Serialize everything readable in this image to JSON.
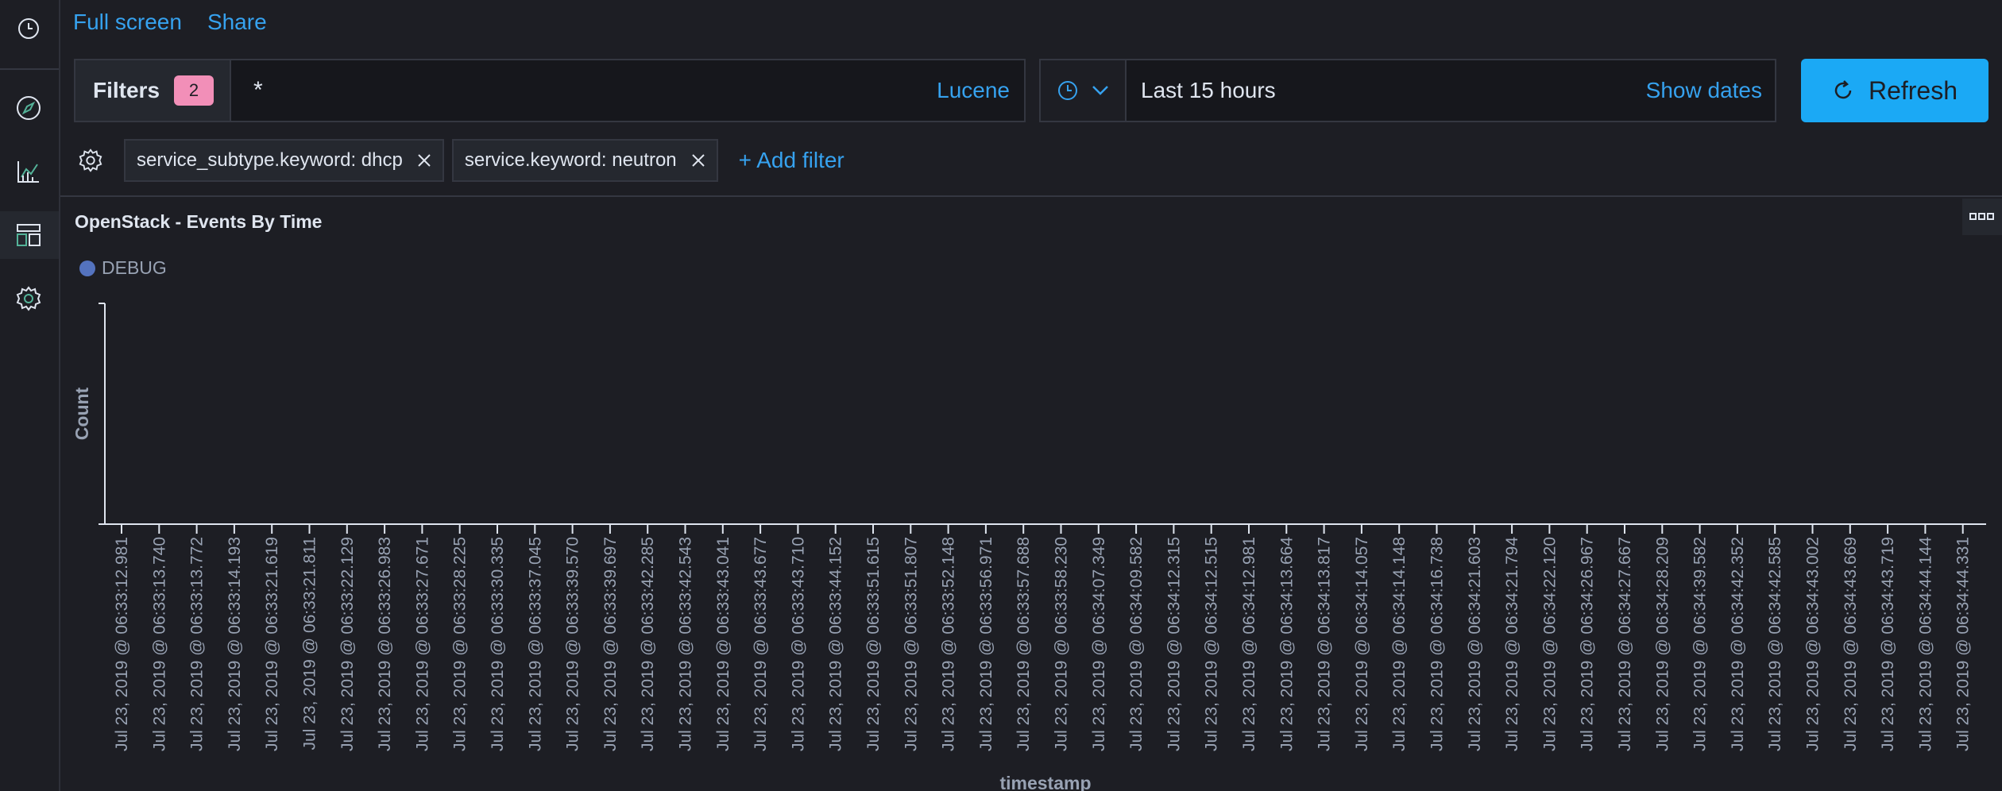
{
  "topbar": {
    "full_screen": "Full screen",
    "share": "Share"
  },
  "query": {
    "filters_label": "Filters",
    "filters_count": "2",
    "text": "*",
    "language": "Lucene"
  },
  "time": {
    "range": "Last 15 hours",
    "show_dates": "Show dates"
  },
  "refresh": {
    "label": "Refresh"
  },
  "filters": [
    {
      "label": "service_subtype.keyword: dhcp"
    },
    {
      "label": "service.keyword: neutron"
    }
  ],
  "add_filter": "+ Add filter",
  "panel": {
    "title": "OpenStack - Events By Time"
  },
  "colors": {
    "accent": "#36a2ef",
    "button": "#1ba9f5",
    "badge": "#f28fb8",
    "series": "#5473bf",
    "background": "#1d1e24"
  },
  "icons": {
    "history": "clock-icon",
    "discover": "compass-icon",
    "visualize": "chart-icon",
    "dashboard": "dashboard-icon",
    "settings": "gear-icon"
  },
  "chart_data": {
    "type": "bar",
    "xlabel": "timestamp",
    "ylabel": "Count",
    "legend": [
      "DEBUG"
    ],
    "legend_position": "top-left",
    "categories": [
      "Jul 23, 2019 @ 06:33:12.981",
      "Jul 23, 2019 @ 06:33:13.740",
      "Jul 23, 2019 @ 06:33:13.772",
      "Jul 23, 2019 @ 06:33:14.193",
      "Jul 23, 2019 @ 06:33:21.619",
      "Jul 23, 2019 @ 06:33:21.811",
      "Jul 23, 2019 @ 06:33:22.129",
      "Jul 23, 2019 @ 06:33:26.983",
      "Jul 23, 2019 @ 06:33:27.671",
      "Jul 23, 2019 @ 06:33:28.225",
      "Jul 23, 2019 @ 06:33:30.335",
      "Jul 23, 2019 @ 06:33:37.045",
      "Jul 23, 2019 @ 06:33:39.570",
      "Jul 23, 2019 @ 06:33:39.697",
      "Jul 23, 2019 @ 06:33:42.285",
      "Jul 23, 2019 @ 06:33:42.543",
      "Jul 23, 2019 @ 06:33:43.041",
      "Jul 23, 2019 @ 06:33:43.677",
      "Jul 23, 2019 @ 06:33:43.710",
      "Jul 23, 2019 @ 06:33:44.152",
      "Jul 23, 2019 @ 06:33:51.615",
      "Jul 23, 2019 @ 06:33:51.807",
      "Jul 23, 2019 @ 06:33:52.148",
      "Jul 23, 2019 @ 06:33:56.971",
      "Jul 23, 2019 @ 06:33:57.688",
      "Jul 23, 2019 @ 06:33:58.230",
      "Jul 23, 2019 @ 06:34:07.349",
      "Jul 23, 2019 @ 06:34:09.582",
      "Jul 23, 2019 @ 06:34:12.315",
      "Jul 23, 2019 @ 06:34:12.515",
      "Jul 23, 2019 @ 06:34:12.981",
      "Jul 23, 2019 @ 06:34:13.664",
      "Jul 23, 2019 @ 06:34:13.817",
      "Jul 23, 2019 @ 06:34:14.057",
      "Jul 23, 2019 @ 06:34:14.148",
      "Jul 23, 2019 @ 06:34:16.738",
      "Jul 23, 2019 @ 06:34:21.603",
      "Jul 23, 2019 @ 06:34:21.794",
      "Jul 23, 2019 @ 06:34:22.120",
      "Jul 23, 2019 @ 06:34:26.967",
      "Jul 23, 2019 @ 06:34:27.667",
      "Jul 23, 2019 @ 06:34:28.209",
      "Jul 23, 2019 @ 06:34:39.582",
      "Jul 23, 2019 @ 06:34:42.352",
      "Jul 23, 2019 @ 06:34:42.585",
      "Jul 23, 2019 @ 06:34:43.002",
      "Jul 23, 2019 @ 06:34:43.669",
      "Jul 23, 2019 @ 06:34:43.719",
      "Jul 23, 2019 @ 06:34:44.144",
      "Jul 23, 2019 @ 06:34:44.331"
    ],
    "grid": false
  }
}
